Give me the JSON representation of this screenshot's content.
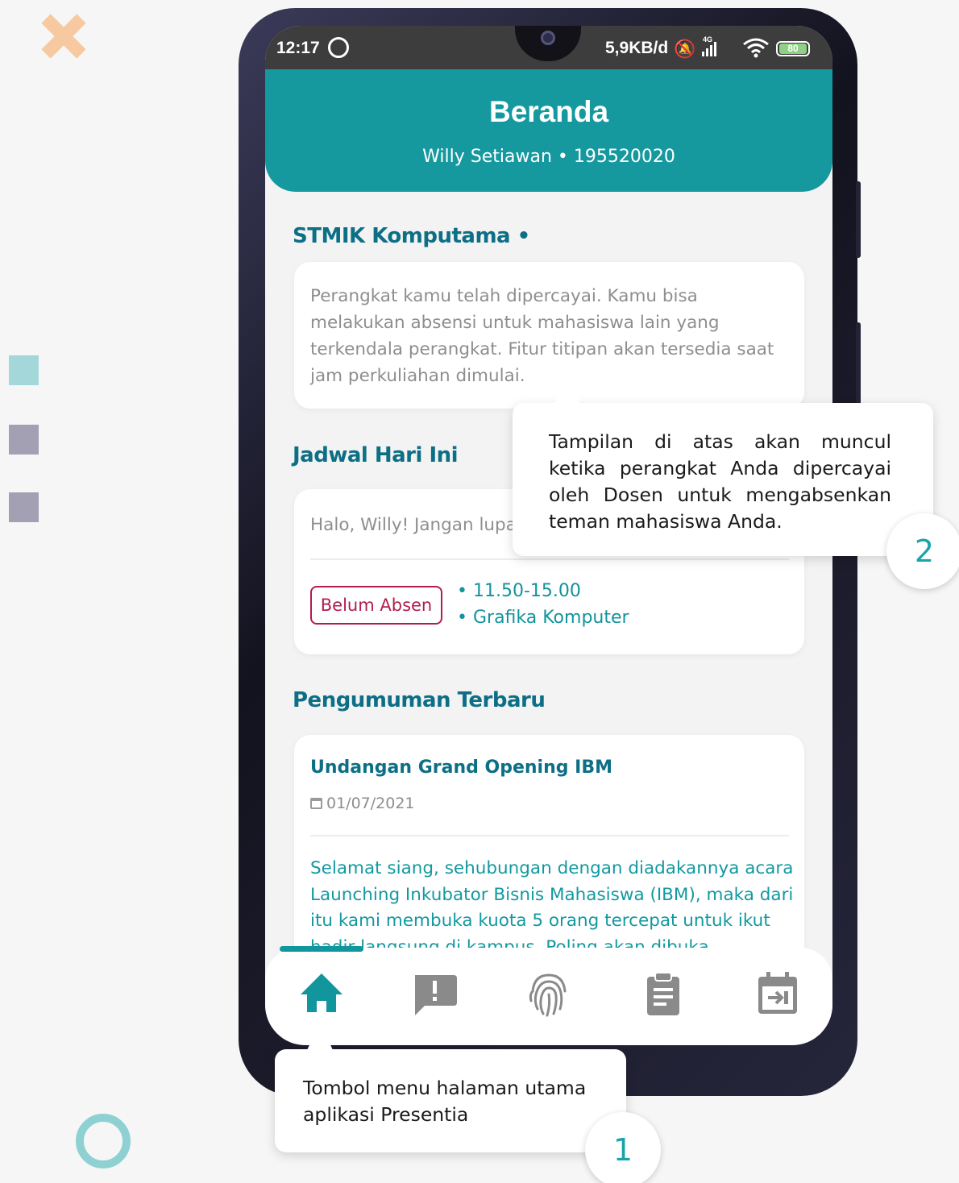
{
  "status_bar": {
    "time": "12:17",
    "network_speed": "5,9KB/d",
    "network_type": "4G",
    "battery": "80",
    "icons": [
      "whatsapp-icon",
      "bell-off-icon",
      "signal-icon",
      "wifi-icon",
      "battery-icon"
    ]
  },
  "header": {
    "title": "Beranda",
    "subtitle": "Willy Setiawan • 195520020"
  },
  "trusted": {
    "title": "STMIK Komputama •",
    "message": "Perangkat kamu telah dipercayai. Kamu bisa melakukan absensi untuk mahasiswa lain yang terkendala perangkat. Fitur titipan akan tersedia saat jam perkuliahan dimulai."
  },
  "schedule": {
    "title": "Jadwal Hari Ini",
    "greeting": "Halo, Willy! Jangan lupa",
    "status": "Belum Absen",
    "time": "• 11.50-15.00",
    "course": "• Grafika Komputer"
  },
  "announcements": {
    "title": "Pengumuman Terbaru",
    "item": {
      "title": "Undangan Grand Opening IBM",
      "date": "01/07/2021",
      "body": "Selamat siang, sehubungan dengan diadakannya acara Launching Inkubator Bisnis Mahasiswa (IBM), maka dari itu kami membuka kuota 5 orang tercepat untuk ikut hadir langsung di kampus. Poling akan dibuka"
    }
  },
  "bottom_nav": {
    "items": [
      "home-icon",
      "announcement-icon",
      "fingerprint-icon",
      "clipboard-icon",
      "calendar-icon"
    ],
    "active_index": 0
  },
  "callouts": [
    {
      "number": "1",
      "text": "Tombol menu halaman utama aplikasi Presentia"
    },
    {
      "number": "2",
      "text": "Tampilan di atas akan muncul ketika perangkat Anda dipercayai oleh Dosen untuk mengabsenkan teman mahasiswa Anda."
    }
  ],
  "colors": {
    "primary": "#15999f",
    "heading": "#0d6f86",
    "badge": "#b01e4b",
    "deco_orange": "#f7c9a0",
    "deco_teal": "#a3d7da",
    "deco_gray": "#a3a0b4"
  }
}
